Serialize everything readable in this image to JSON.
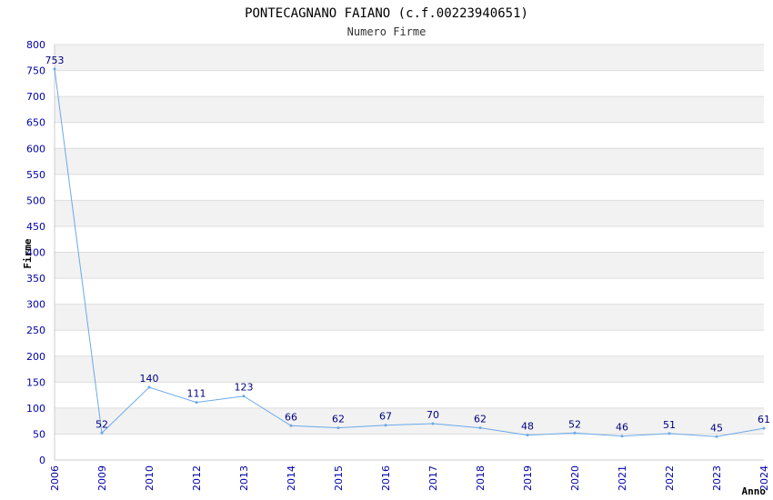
{
  "chart_data": {
    "type": "line",
    "title": "PONTECAGNANO FAIANO (c.f.00223940651)",
    "subtitle": "Numero Firme",
    "xlabel": "Anno",
    "ylabel": "Firme",
    "categories": [
      "2006",
      "2009",
      "2010",
      "2012",
      "2013",
      "2014",
      "2015",
      "2016",
      "2017",
      "2018",
      "2019",
      "2020",
      "2021",
      "2022",
      "2023",
      "2024"
    ],
    "series": [
      {
        "values": [
          753,
          52,
          140,
          111,
          123,
          66,
          62,
          67,
          70,
          62,
          48,
          52,
          46,
          51,
          45,
          61
        ]
      }
    ],
    "ylim": [
      0,
      800
    ],
    "ytick_step": 50,
    "grid": true,
    "line_color": "#6aa9e9",
    "band_color": "#f2f2f2",
    "tick_color": "#0000aa"
  }
}
